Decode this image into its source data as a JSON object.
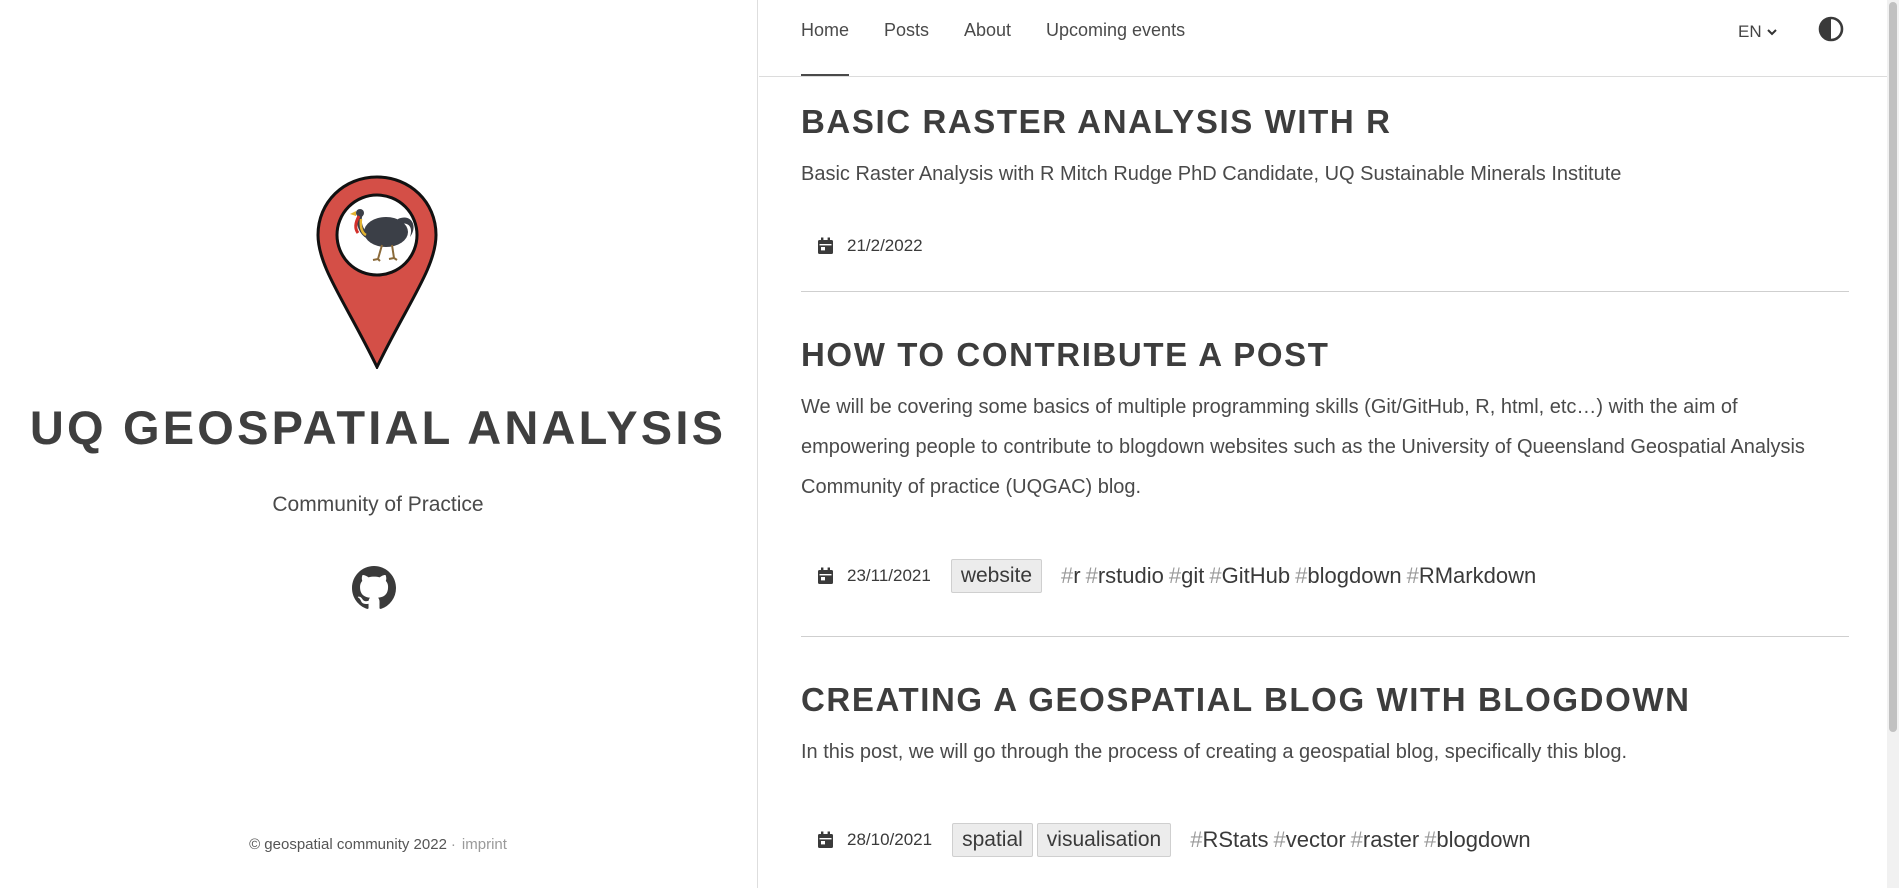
{
  "sidebar": {
    "title": "UQ GEOSPATIAL ANALYSIS",
    "subtitle": "Community of Practice",
    "github_icon": "github-icon",
    "footer": {
      "copyright": "© geospatial community 2022",
      "separator": "·",
      "imprint": "imprint"
    }
  },
  "nav": {
    "items": [
      "Home",
      "Posts",
      "About",
      "Upcoming events"
    ],
    "active": "Home",
    "language": "EN",
    "theme_toggle_icon": "contrast-icon"
  },
  "posts": [
    {
      "title": "BASIC RASTER ANALYSIS WITH R",
      "summary": "Basic Raster Analysis with R Mitch Rudge PhD Candidate, UQ Sustainable Minerals Institute",
      "date": "21/2/2022",
      "categories": [],
      "tags": []
    },
    {
      "title": "HOW TO CONTRIBUTE A POST",
      "summary": "We will be covering some basics of multiple programming skills (Git/GitHub, R, html, etc…) with the aim of empowering people to contribute to blogdown websites such as the University of Queensland Geospatial Analysis Community of practice (UQGAC) blog.",
      "date": "23/11/2021",
      "categories": [
        "website"
      ],
      "tags": [
        "r",
        "rstudio",
        "git",
        "GitHub",
        "blogdown",
        "RMarkdown"
      ]
    },
    {
      "title": "CREATING A GEOSPATIAL BLOG WITH BLOGDOWN",
      "summary": "In this post, we will go through the process of creating a geospatial blog, specifically this blog.",
      "date": "28/10/2021",
      "categories": [
        "spatial",
        "visualisation"
      ],
      "tags": [
        "RStats",
        "vector",
        "raster",
        "blogdown"
      ]
    }
  ],
  "colors": {
    "marker_red": "#d44f47",
    "text": "#4a4a4a",
    "title": "#3d3d3d",
    "tag_hash": "#9a9a9a",
    "category_bg": "#ececec"
  }
}
